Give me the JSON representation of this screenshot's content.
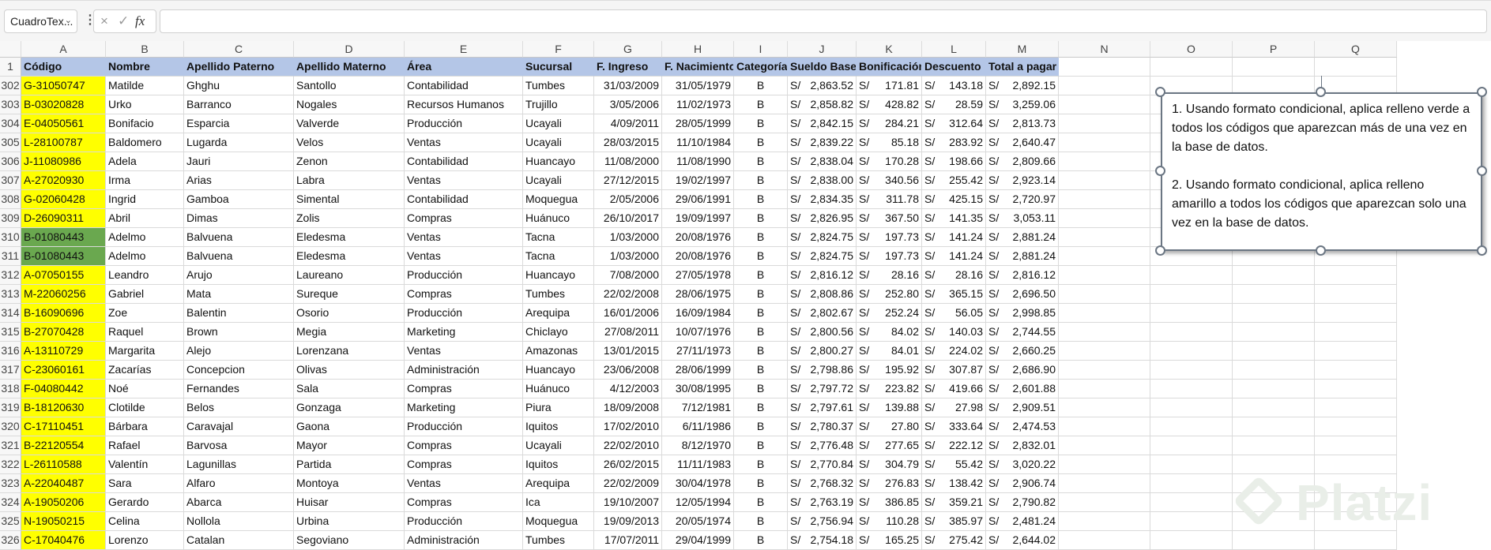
{
  "formula_bar": {
    "name_box": "CuadroTex...",
    "fx_label": "fx",
    "cancel_icon": "×",
    "enter_icon": "✓",
    "value": ""
  },
  "columns": [
    "A",
    "B",
    "C",
    "D",
    "E",
    "F",
    "G",
    "H",
    "I",
    "J",
    "K",
    "L",
    "M",
    "N",
    "O",
    "P",
    "Q"
  ],
  "headers": [
    "Código",
    "Nombre",
    "Apellido Paterno",
    "Apellido Materno",
    "Área",
    "Sucursal",
    "F. Ingreso",
    "F. Nacimiento",
    "Categoría",
    "Sueldo Base",
    "Bonificación",
    "Descuento",
    "Total a pagar"
  ],
  "currency": "S/",
  "colors": {
    "header_fill": "#b4c6e7",
    "unique_fill": "#ffff00",
    "duplicate_fill": "#6aa84f"
  },
  "rows": [
    {
      "n": "302",
      "fill": "yellow",
      "v": [
        "G-31050747",
        "Matilde",
        "Ghghu",
        "Santollo",
        "Contabilidad",
        "Tumbes",
        "31/03/2009",
        "31/05/1979",
        "B",
        "2,863.52",
        "171.81",
        "143.18",
        "2,892.15"
      ]
    },
    {
      "n": "303",
      "fill": "yellow",
      "v": [
        "B-03020828",
        "Urko",
        "Barranco",
        "Nogales",
        "Recursos Humanos",
        "Trujillo",
        "3/05/2006",
        "11/02/1973",
        "B",
        "2,858.82",
        "428.82",
        "28.59",
        "3,259.06"
      ]
    },
    {
      "n": "304",
      "fill": "yellow",
      "v": [
        "E-04050561",
        "Bonifacio",
        "Esparcia",
        "Valverde",
        "Producción",
        "Ucayali",
        "4/09/2011",
        "28/05/1999",
        "B",
        "2,842.15",
        "284.21",
        "312.64",
        "2,813.73"
      ]
    },
    {
      "n": "305",
      "fill": "yellow",
      "v": [
        "L-28100787",
        "Baldomero",
        "Lugarda",
        "Velos",
        "Ventas",
        "Ucayali",
        "28/03/2015",
        "11/10/1984",
        "B",
        "2,839.22",
        "85.18",
        "283.92",
        "2,640.47"
      ]
    },
    {
      "n": "306",
      "fill": "yellow",
      "v": [
        "J-11080986",
        "Adela",
        "Jauri",
        "Zenon",
        "Contabilidad",
        "Huancayo",
        "11/08/2000",
        "11/08/1990",
        "B",
        "2,838.04",
        "170.28",
        "198.66",
        "2,809.66"
      ]
    },
    {
      "n": "307",
      "fill": "yellow",
      "v": [
        "A-27020930",
        "Irma",
        "Arias",
        "Labra",
        "Ventas",
        "Ucayali",
        "27/12/2015",
        "19/02/1997",
        "B",
        "2,838.00",
        "340.56",
        "255.42",
        "2,923.14"
      ]
    },
    {
      "n": "308",
      "fill": "yellow",
      "v": [
        "G-02060428",
        "Ingrid",
        "Gamboa",
        "Simental",
        "Contabilidad",
        "Moquegua",
        "2/05/2006",
        "29/06/1991",
        "B",
        "2,834.35",
        "311.78",
        "425.15",
        "2,720.97"
      ]
    },
    {
      "n": "309",
      "fill": "yellow",
      "v": [
        "D-26090311",
        "Abril",
        "Dimas",
        "Zolis",
        "Compras",
        "Huánuco",
        "26/10/2017",
        "19/09/1997",
        "B",
        "2,826.95",
        "367.50",
        "141.35",
        "3,053.11"
      ]
    },
    {
      "n": "310",
      "fill": "green",
      "v": [
        "B-01080443",
        "Adelmo",
        "Balvuena",
        "Eledesma",
        "Ventas",
        "Tacna",
        "1/03/2000",
        "20/08/1976",
        "B",
        "2,824.75",
        "197.73",
        "141.24",
        "2,881.24"
      ]
    },
    {
      "n": "311",
      "fill": "green",
      "v": [
        "B-01080443",
        "Adelmo",
        "Balvuena",
        "Eledesma",
        "Ventas",
        "Tacna",
        "1/03/2000",
        "20/08/1976",
        "B",
        "2,824.75",
        "197.73",
        "141.24",
        "2,881.24"
      ]
    },
    {
      "n": "312",
      "fill": "yellow",
      "v": [
        "A-07050155",
        "Leandro",
        "Arujo",
        "Laureano",
        "Producción",
        "Huancayo",
        "7/08/2000",
        "27/05/1978",
        "B",
        "2,816.12",
        "28.16",
        "28.16",
        "2,816.12"
      ]
    },
    {
      "n": "313",
      "fill": "yellow",
      "v": [
        "M-22060256",
        "Gabriel",
        "Mata",
        "Sureque",
        "Compras",
        "Tumbes",
        "22/02/2008",
        "28/06/1975",
        "B",
        "2,808.86",
        "252.80",
        "365.15",
        "2,696.50"
      ]
    },
    {
      "n": "314",
      "fill": "yellow",
      "v": [
        "B-16090696",
        "Zoe",
        "Balentin",
        "Osorio",
        "Producción",
        "Arequipa",
        "16/01/2006",
        "16/09/1984",
        "B",
        "2,802.67",
        "252.24",
        "56.05",
        "2,998.85"
      ]
    },
    {
      "n": "315",
      "fill": "yellow",
      "v": [
        "B-27070428",
        "Raquel",
        "Brown",
        "Megia",
        "Marketing",
        "Chiclayo",
        "27/08/2011",
        "10/07/1976",
        "B",
        "2,800.56",
        "84.02",
        "140.03",
        "2,744.55"
      ]
    },
    {
      "n": "316",
      "fill": "yellow",
      "v": [
        "A-13110729",
        "Margarita",
        "Alejo",
        "Lorenzana",
        "Ventas",
        "Amazonas",
        "13/01/2015",
        "27/11/1973",
        "B",
        "2,800.27",
        "84.01",
        "224.02",
        "2,660.25"
      ]
    },
    {
      "n": "317",
      "fill": "yellow",
      "v": [
        "C-23060161",
        "Zacarías",
        "Concepcion",
        "Olivas",
        "Administración",
        "Huancayo",
        "23/06/2008",
        "28/06/1999",
        "B",
        "2,798.86",
        "195.92",
        "307.87",
        "2,686.90"
      ]
    },
    {
      "n": "318",
      "fill": "yellow",
      "v": [
        "F-04080442",
        "Noé",
        "Fernandes",
        "Sala",
        "Compras",
        "Huánuco",
        "4/12/2003",
        "30/08/1995",
        "B",
        "2,797.72",
        "223.82",
        "419.66",
        "2,601.88"
      ]
    },
    {
      "n": "319",
      "fill": "yellow",
      "v": [
        "B-18120630",
        "Clotilde",
        "Belos",
        "Gonzaga",
        "Marketing",
        "Piura",
        "18/09/2008",
        "7/12/1981",
        "B",
        "2,797.61",
        "139.88",
        "27.98",
        "2,909.51"
      ]
    },
    {
      "n": "320",
      "fill": "yellow",
      "v": [
        "C-17110451",
        "Bárbara",
        "Caravajal",
        "Gaona",
        "Producción",
        "Iquitos",
        "17/02/2010",
        "6/11/1986",
        "B",
        "2,780.37",
        "27.80",
        "333.64",
        "2,474.53"
      ]
    },
    {
      "n": "321",
      "fill": "yellow",
      "v": [
        "B-22120554",
        "Rafael",
        "Barvosa",
        "Mayor",
        "Compras",
        "Ucayali",
        "22/02/2010",
        "8/12/1970",
        "B",
        "2,776.48",
        "277.65",
        "222.12",
        "2,832.01"
      ]
    },
    {
      "n": "322",
      "fill": "yellow",
      "v": [
        "L-26110588",
        "Valentín",
        "Lagunillas",
        "Partida",
        "Compras",
        "Iquitos",
        "26/02/2015",
        "11/11/1983",
        "B",
        "2,770.84",
        "304.79",
        "55.42",
        "3,020.22"
      ]
    },
    {
      "n": "323",
      "fill": "yellow",
      "v": [
        "A-22040487",
        "Sara",
        "Alfaro",
        "Montoya",
        "Ventas",
        "Arequipa",
        "22/02/2009",
        "30/04/1978",
        "B",
        "2,768.32",
        "276.83",
        "138.42",
        "2,906.74"
      ]
    },
    {
      "n": "324",
      "fill": "yellow",
      "v": [
        "A-19050206",
        "Gerardo",
        "Abarca",
        "Huisar",
        "Compras",
        "Ica",
        "19/10/2007",
        "12/05/1994",
        "B",
        "2,763.19",
        "386.85",
        "359.21",
        "2,790.82"
      ]
    },
    {
      "n": "325",
      "fill": "yellow",
      "v": [
        "N-19050215",
        "Celina",
        "Nollola",
        "Urbina",
        "Producción",
        "Moquegua",
        "19/09/2013",
        "20/05/1974",
        "B",
        "2,756.94",
        "110.28",
        "385.97",
        "2,481.24"
      ]
    },
    {
      "n": "326",
      "fill": "yellow",
      "v": [
        "C-17040476",
        "Lorenzo",
        "Catalan",
        "Segoviano",
        "Administración",
        "Tumbes",
        "17/07/2011",
        "29/04/1999",
        "B",
        "2,754.18",
        "165.25",
        "275.42",
        "2,644.02"
      ]
    }
  ],
  "header_row_number": "1",
  "textbox": {
    "p1": "1. Usando formato condicional, aplica relleno verde a todos los códigos que aparezcan más de una vez en la base de datos.",
    "p2": "2. Usando formato condicional, aplica relleno amarillo a todos los códigos que aparezcan solo una vez en la base de datos."
  },
  "watermark": "Platzi"
}
